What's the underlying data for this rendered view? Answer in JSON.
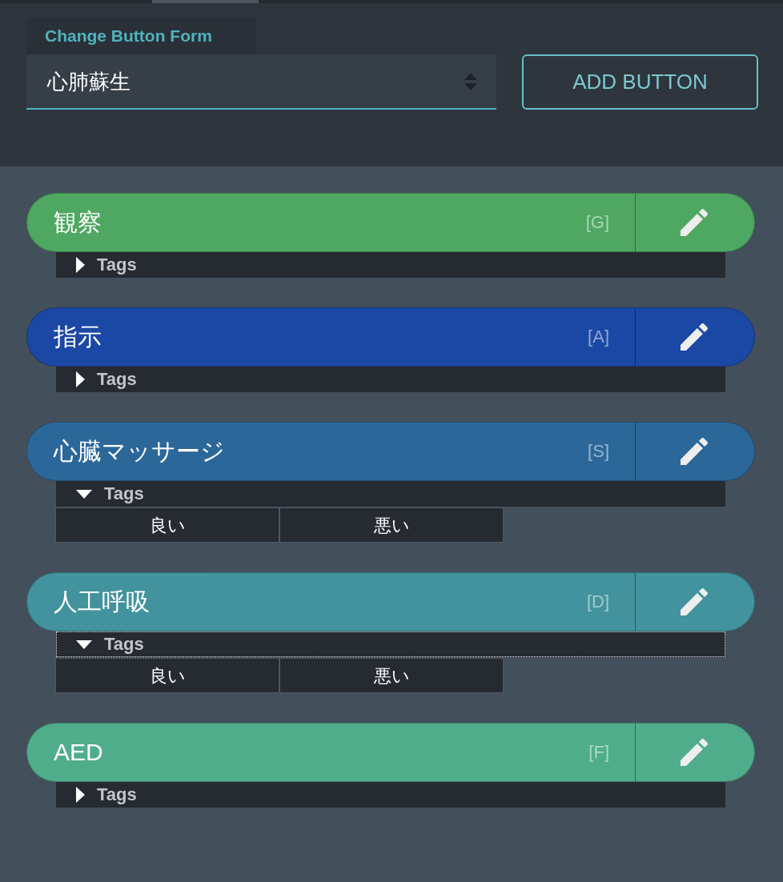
{
  "form_selector": {
    "label": "Change Button Form",
    "value": "心肺蘇生"
  },
  "add_button": {
    "label": "ADD BUTTON"
  },
  "buttons": [
    {
      "label": "観察",
      "shortcut": "[G]",
      "color": "#4fa862",
      "tags": {
        "label": "Tags",
        "expanded": false,
        "focused": false
      }
    },
    {
      "label": "指示",
      "shortcut": "[A]",
      "color": "#1c48a5",
      "tags": {
        "label": "Tags",
        "expanded": false,
        "focused": false
      }
    },
    {
      "label": "心臓マッサージ",
      "shortcut": "[S]",
      "color": "#2c6799",
      "tags": {
        "label": "Tags",
        "expanded": true,
        "focused": false,
        "items": [
          {
            "label": "良い"
          },
          {
            "label": "悪い"
          }
        ]
      }
    },
    {
      "label": "人工呼吸",
      "shortcut": "[D]",
      "color": "#42939d",
      "tags": {
        "label": "Tags",
        "expanded": true,
        "focused": true,
        "items": [
          {
            "label": "良い"
          },
          {
            "label": "悪い"
          }
        ]
      }
    },
    {
      "label": "AED",
      "shortcut": "[F]",
      "color": "#50ad8b",
      "tags": {
        "label": "Tags",
        "expanded": false,
        "focused": false
      }
    }
  ]
}
